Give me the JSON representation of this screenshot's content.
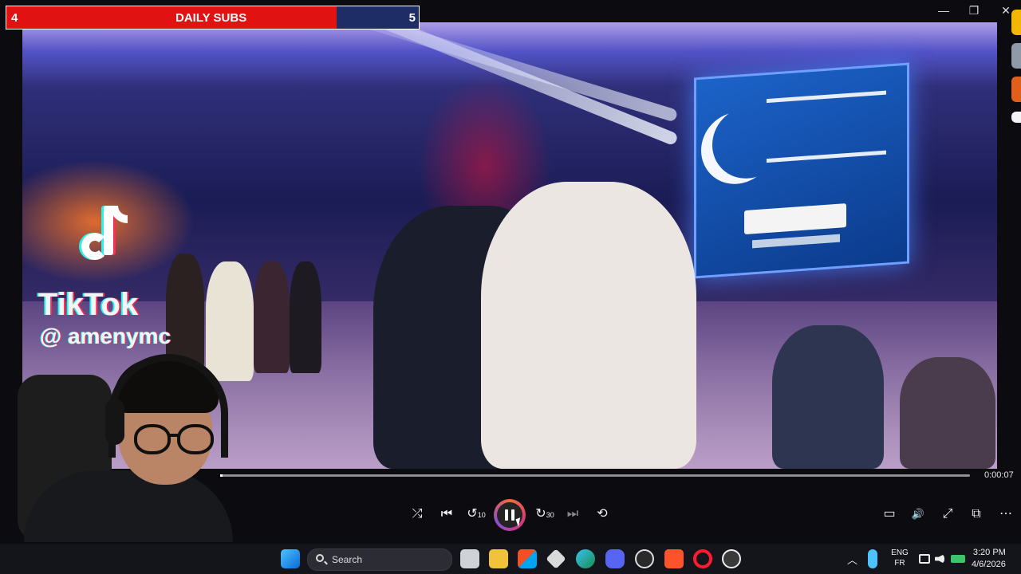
{
  "subs_overlay": {
    "current": "4",
    "title": "DAILY SUBS",
    "goal": "5",
    "progress_fraction": 0.8,
    "fill_color": "#e01212",
    "bg_color": "#1f2d66"
  },
  "video": {
    "watermark_brand": "TikTok",
    "watermark_handle": "@ amenymc"
  },
  "player": {
    "elapsed_time": "0:00:07",
    "progress_fraction": 0.003,
    "controls": {
      "shuffle_icon": "⤮",
      "previous_icon": "⏮",
      "rewind_icon": "↺",
      "rewind_label": "10",
      "play_pause_state": "playing",
      "forward_icon": "↻",
      "forward_label": "30",
      "next_icon": "⏭",
      "repeat_icon": "⟲",
      "subtitles_icon": "▭",
      "volume_icon": "🔊",
      "fullscreen_icon": "⤢",
      "miniplayer_icon": "⧉",
      "more_icon": "⋯"
    }
  },
  "window_controls": {
    "minimize": "—",
    "restore": "❐",
    "close": "✕"
  },
  "taskbar": {
    "search_placeholder": "Search",
    "language_top": "ENG",
    "language_bottom": "FR",
    "time": "3:20 PM",
    "date": "4/6/2026",
    "tray_chevron": "︿",
    "apps": [
      "start",
      "task-view",
      "file-explorer",
      "microsoft-store",
      "unity",
      "edge",
      "discord",
      "obs",
      "brave",
      "opera-gx",
      "media-player"
    ]
  }
}
